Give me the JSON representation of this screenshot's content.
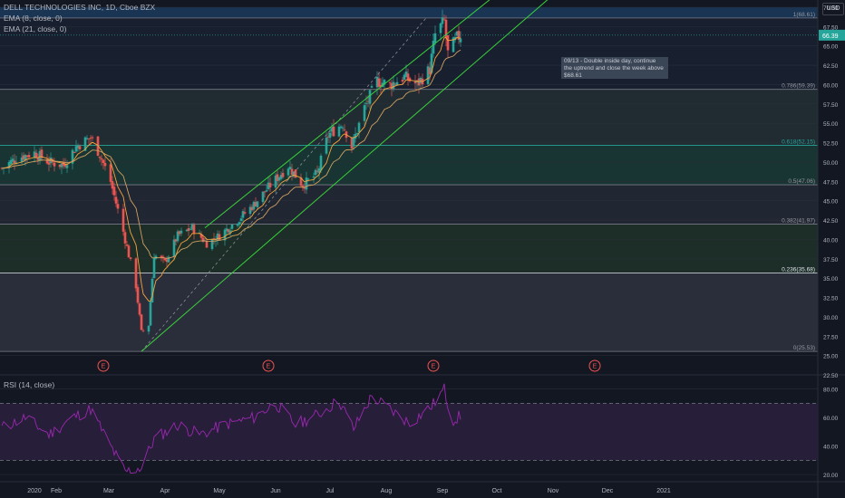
{
  "header": {
    "symbol_line": "DELL TECHNOLOGIES INC, 1D, Cboe BZX",
    "indicators": [
      "EMA (8, close, 0)",
      "EMA (21, close, 0)"
    ]
  },
  "currency": "USD",
  "rsi_label": "RSI (14, close)",
  "note": "09/13 - Double inside day, continue the uptrend and close the week above $68.61",
  "last_price": "66.39",
  "colors": {
    "background": "#131722",
    "up": "#26a69a",
    "down": "#ef5350",
    "ema8": "#f6a33c",
    "ema21": "#d0a060",
    "channel": "#3ad33a",
    "rsi": "#9c27b0",
    "earnings": "#ef5350"
  },
  "chart_data": [
    {
      "type": "candlestick",
      "title": "DELL TECHNOLOGIES INC, 1D, Cboe BZX",
      "ylim": [
        22.5,
        70
      ],
      "y_ticks": [
        "70.00",
        "67.50",
        "65.00",
        "62.50",
        "60.00",
        "57.50",
        "55.00",
        "52.50",
        "50.00",
        "47.50",
        "45.00",
        "42.50",
        "40.00",
        "37.50",
        "35.00",
        "32.50",
        "30.00",
        "27.50",
        "25.00",
        "22.50"
      ],
      "x_ticks": [
        "2020",
        "Feb",
        "Mar",
        "Apr",
        "May",
        "Jun",
        "Jul",
        "Aug",
        "Sep",
        "Oct",
        "Nov",
        "Dec",
        "2021"
      ],
      "fib_levels": [
        {
          "label": "1(68.61)",
          "value": 68.61
        },
        {
          "label": "0.786(59.39)",
          "value": 59.39
        },
        {
          "label": "0.618(52.15)",
          "value": 52.15
        },
        {
          "label": "0.5(47.06)",
          "value": 47.06
        },
        {
          "label": "0.382(41.97)",
          "value": 41.97
        },
        {
          "label": "0.236(35.68)",
          "value": 35.68
        },
        {
          "label": "0(25.53)",
          "value": 25.53
        }
      ],
      "earnings_marker": "E",
      "series": [
        {
          "name": "EMA (8, close, 0)"
        },
        {
          "name": "EMA (21, close, 0)"
        }
      ],
      "price_path": [
        [
          "2020-01-02",
          49.2
        ],
        [
          "2020-01-10",
          50.5
        ],
        [
          "2020-01-20",
          51.2
        ],
        [
          "2020-01-28",
          50.0
        ],
        [
          "2020-02-05",
          49.6
        ],
        [
          "2020-02-12",
          52.0
        ],
        [
          "2020-02-20",
          53.2
        ],
        [
          "2020-02-25",
          51.0
        ],
        [
          "2020-03-02",
          47.5
        ],
        [
          "2020-03-09",
          41.0
        ],
        [
          "2020-03-16",
          34.0
        ],
        [
          "2020-03-19",
          28.0
        ],
        [
          "2020-03-23",
          29.0
        ],
        [
          "2020-03-26",
          38.0
        ],
        [
          "2020-04-01",
          37.0
        ],
        [
          "2020-04-08",
          40.5
        ],
        [
          "2020-04-16",
          41.5
        ],
        [
          "2020-04-24",
          39.5
        ],
        [
          "2020-05-01",
          40.5
        ],
        [
          "2020-05-11",
          42.5
        ],
        [
          "2020-05-20",
          44.5
        ],
        [
          "2020-05-29",
          47.0
        ],
        [
          "2020-06-08",
          49.5
        ],
        [
          "2020-06-16",
          47.0
        ],
        [
          "2020-06-24",
          48.5
        ],
        [
          "2020-06-30",
          53.5
        ],
        [
          "2020-07-08",
          55.0
        ],
        [
          "2020-07-13",
          52.0
        ],
        [
          "2020-07-20",
          57.0
        ],
        [
          "2020-07-27",
          60.5
        ],
        [
          "2020-08-03",
          60.0
        ],
        [
          "2020-08-11",
          61.0
        ],
        [
          "2020-08-18",
          60.0
        ],
        [
          "2020-08-25",
          62.0
        ],
        [
          "2020-08-28",
          66.5
        ],
        [
          "2020-09-02",
          68.2
        ],
        [
          "2020-09-04",
          64.0
        ],
        [
          "2020-09-09",
          66.0
        ],
        [
          "2020-09-11",
          66.39
        ]
      ],
      "earnings_dates": [
        "2020-02-27",
        "2020-05-28",
        "2020-08-27",
        "2020-11-24"
      ]
    },
    {
      "type": "line",
      "title": "RSI (14, close)",
      "ylim": [
        15,
        90
      ],
      "y_ticks": [
        "80.00",
        "60.00",
        "40.00",
        "20.00"
      ],
      "bands": [
        70,
        30
      ],
      "values_path": [
        [
          "2020-01-02",
          53
        ],
        [
          "2020-01-15",
          60
        ],
        [
          "2020-01-28",
          48
        ],
        [
          "2020-02-10",
          60
        ],
        [
          "2020-02-20",
          66
        ],
        [
          "2020-03-02",
          40
        ],
        [
          "2020-03-10",
          22
        ],
        [
          "2020-03-19",
          25
        ],
        [
          "2020-03-26",
          45
        ],
        [
          "2020-04-08",
          55
        ],
        [
          "2020-04-20",
          48
        ],
        [
          "2020-05-04",
          55
        ],
        [
          "2020-05-20",
          60
        ],
        [
          "2020-06-01",
          70
        ],
        [
          "2020-06-12",
          55
        ],
        [
          "2020-06-24",
          62
        ],
        [
          "2020-07-06",
          72
        ],
        [
          "2020-07-14",
          52
        ],
        [
          "2020-07-24",
          75
        ],
        [
          "2020-08-04",
          65
        ],
        [
          "2020-08-14",
          56
        ],
        [
          "2020-08-26",
          68
        ],
        [
          "2020-09-02",
          80
        ],
        [
          "2020-09-06",
          58
        ],
        [
          "2020-09-11",
          61
        ]
      ]
    }
  ]
}
